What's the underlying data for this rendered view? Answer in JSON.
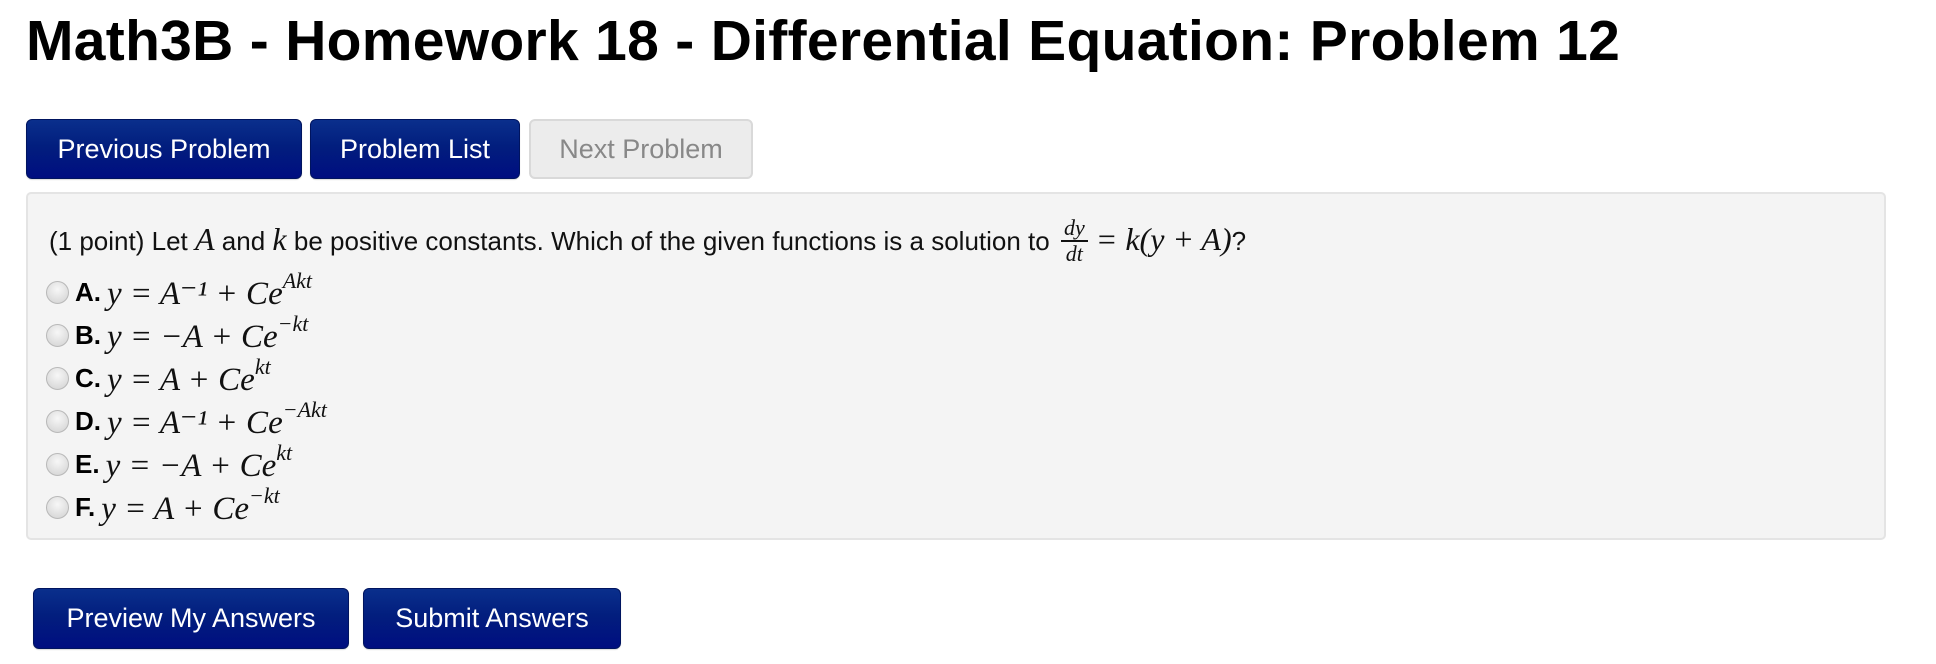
{
  "page": {
    "title": "Math3B - Homework 18 - Differential Equation: Problem 12"
  },
  "nav": {
    "previous_label": "Previous Problem",
    "list_label": "Problem List",
    "next_label": "Next Problem",
    "next_disabled": true
  },
  "problem": {
    "points": "(1 point)",
    "text_1": "Let",
    "var_A": "A",
    "text_2": "and",
    "var_k": "k",
    "text_3": "be positive constants. Which of the given functions is a solution to",
    "fraction_numerator": "dy",
    "fraction_denominator": "dt",
    "equation_rhs": "= k(y + A)",
    "text_end": "?",
    "choices": [
      {
        "label": "A.",
        "base": "y = A⁻¹ + Ce",
        "exponent": "Akt"
      },
      {
        "label": "B.",
        "base": "y = −A + Ce",
        "exponent": "−kt"
      },
      {
        "label": "C.",
        "base": "y = A + Ce",
        "exponent": "kt"
      },
      {
        "label": "D.",
        "base": "y = A⁻¹ + Ce",
        "exponent": "−Akt"
      },
      {
        "label": "E.",
        "base": "y = −A + Ce",
        "exponent": "kt"
      },
      {
        "label": "F.",
        "base": "y = A + Ce",
        "exponent": "−kt"
      }
    ]
  },
  "actions": {
    "preview_label": "Preview My Answers",
    "submit_label": "Submit Answers"
  },
  "colors": {
    "primary_button": "#021e7e",
    "disabled_button": "#ececec",
    "panel_background": "#f4f4f4"
  }
}
